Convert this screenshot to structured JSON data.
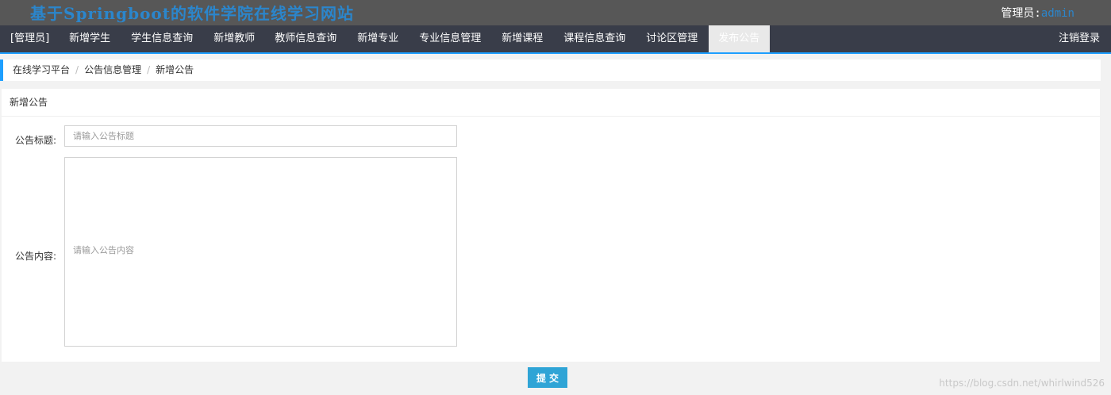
{
  "header": {
    "site_title": "基于Springboot的软件学院在线学习网站",
    "admin_label": "管理员:",
    "admin_name": "admin"
  },
  "nav": {
    "items": [
      {
        "label": "[管理员]"
      },
      {
        "label": "新增学生"
      },
      {
        "label": "学生信息查询"
      },
      {
        "label": "新增教师"
      },
      {
        "label": "教师信息查询"
      },
      {
        "label": "新增专业"
      },
      {
        "label": "专业信息管理"
      },
      {
        "label": "新增课程"
      },
      {
        "label": "课程信息查询"
      },
      {
        "label": "讨论区管理"
      },
      {
        "label": "发布公告"
      }
    ],
    "active_index": 10,
    "logout_label": "注销登录"
  },
  "breadcrumb": {
    "items": [
      "在线学习平台",
      "公告信息管理",
      "新增公告"
    ],
    "separator": "/"
  },
  "form": {
    "panel_title": "新增公告",
    "title_label": "公告标题:",
    "title_value": "",
    "title_placeholder": "请输入公告标题",
    "content_label": "公告内容:",
    "content_value": "",
    "content_placeholder": "请输入公告内容",
    "submit_label": "提交"
  },
  "watermark": "https://blog.csdn.net/whirlwind526",
  "colors": {
    "topbar": "#575757",
    "navbar": "#393d49",
    "accent": "#1e9fff",
    "title": "#2b86cc",
    "submit": "#2fa4d6"
  }
}
